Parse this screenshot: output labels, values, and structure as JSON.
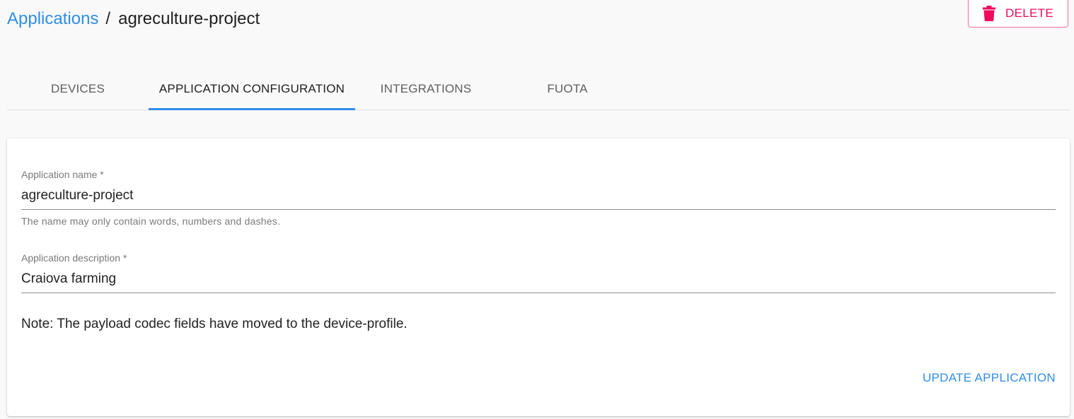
{
  "breadcrumb": {
    "parent": "Applications",
    "separator": "/",
    "current": "agreculture-project"
  },
  "actions": {
    "delete_label": "DELETE",
    "delete_icon": "trash-icon",
    "delete_color": "#ef0b5f"
  },
  "tabs": [
    {
      "label": "DEVICES",
      "active": false
    },
    {
      "label": "APPLICATION CONFIGURATION",
      "active": true
    },
    {
      "label": "INTEGRATIONS",
      "active": false
    },
    {
      "label": "FUOTA",
      "active": false
    }
  ],
  "form": {
    "name": {
      "label": "Application name *",
      "value": "agreculture-project",
      "helper": "The name may only contain words, numbers and dashes."
    },
    "description": {
      "label": "Application description *",
      "value": "Craiova farming"
    },
    "note": "Note: The payload codec fields have moved to the device-profile.",
    "submit_label": "UPDATE APPLICATION"
  },
  "colors": {
    "accent": "#2f8ee5",
    "danger": "#ef0b5f"
  }
}
